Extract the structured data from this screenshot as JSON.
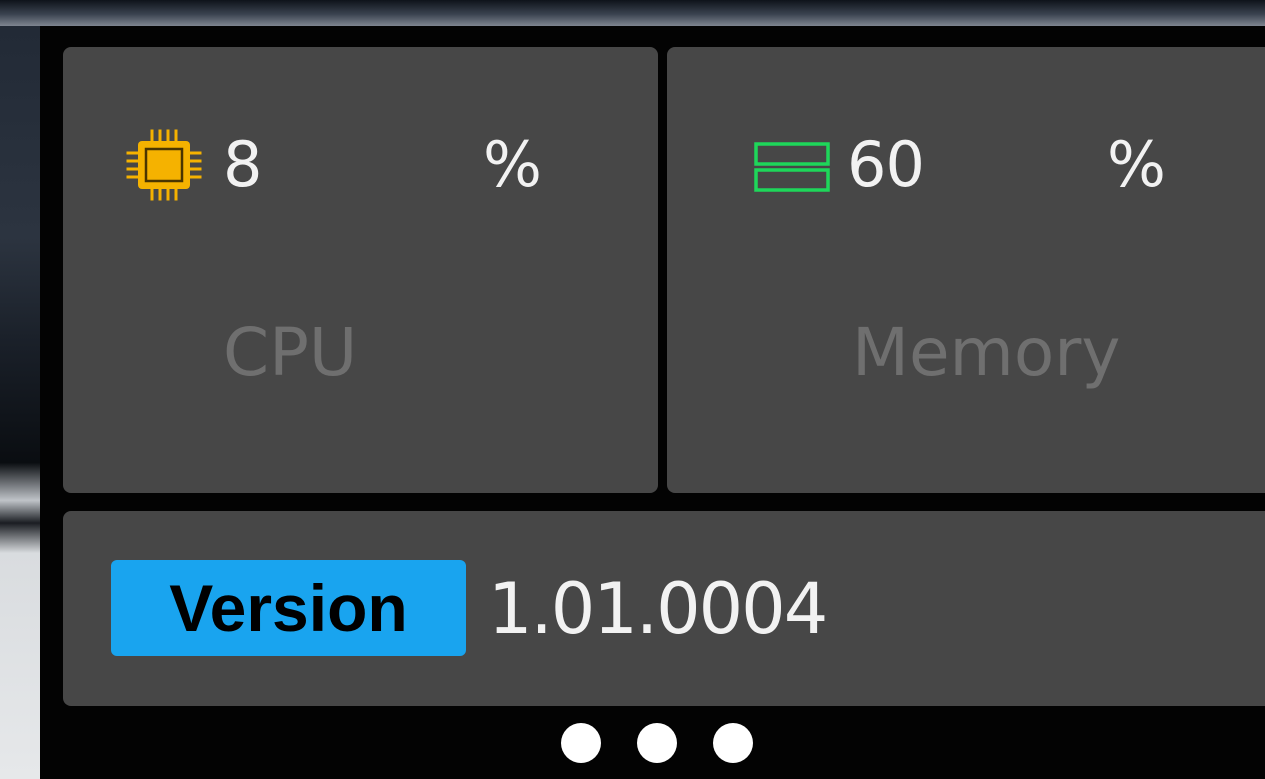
{
  "cpu": {
    "value": "8",
    "unit": "%",
    "label": "CPU",
    "icon": "cpu-chip-icon",
    "icon_color": "#f5b200"
  },
  "memory": {
    "value": "60",
    "unit": "%",
    "label": "Memory",
    "icon": "memory-icon",
    "icon_color": "#1ed75a"
  },
  "version": {
    "badge_label": "Version",
    "value": "1.01.0004",
    "badge_color": "#19a4ef"
  },
  "pager": {
    "page_count": 3,
    "dot_color": "#ffffff"
  }
}
